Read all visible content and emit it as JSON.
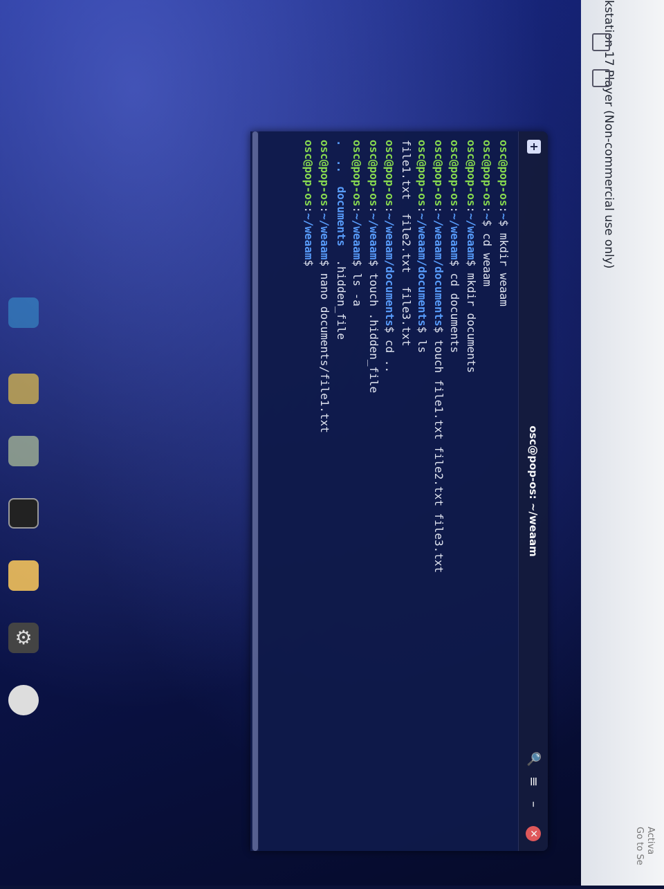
{
  "player": {
    "title": "kstation 17 Player (Non-commercial use only)"
  },
  "overlay": {
    "activate_line1": "Activa",
    "activate_line2": "Go to Se"
  },
  "terminal": {
    "title": "osc@pop-os: ~/weaam",
    "lines": [
      {
        "user": "osc@pop-os",
        "path": "~",
        "cmd": " mkdir weaam"
      },
      {
        "user": "osc@pop-os",
        "path": "~",
        "cmd": " cd weaam"
      },
      {
        "user": "osc@pop-os",
        "path": "~/weaam",
        "cmd": " mkdir documents"
      },
      {
        "user": "osc@pop-os",
        "path": "~/weaam",
        "cmd": " cd documents"
      },
      {
        "user": "osc@pop-os",
        "path": "~/weaam/documents",
        "cmd": " touch file1.txt file2.txt file3.txt"
      },
      {
        "user": "osc@pop-os",
        "path": "~/weaam/documents",
        "cmd": " ls"
      },
      {
        "output": "file1.txt  file2.txt  file3.txt"
      },
      {
        "user": "osc@pop-os",
        "path": "~/weaam/documents",
        "cmd": " cd .."
      },
      {
        "user": "osc@pop-os",
        "path": "~/weaam",
        "cmd": " touch .hidden_file"
      },
      {
        "user": "osc@pop-os",
        "path": "~/weaam",
        "cmd": " ls -a"
      },
      {
        "ls_a": [
          ".",
          "..",
          "documents",
          ".hidden_file"
        ]
      },
      {
        "user": "osc@pop-os",
        "path": "~/weaam",
        "cmd": " nano documents/file1.txt"
      },
      {
        "user": "osc@pop-os",
        "path": "~/weaam",
        "cmd": ""
      }
    ]
  },
  "icons": {
    "new_tab": "new-tab-icon",
    "search": "search-icon",
    "menu": "hamburger-menu-icon",
    "minimize": "minimize-icon",
    "close": "close-icon"
  }
}
